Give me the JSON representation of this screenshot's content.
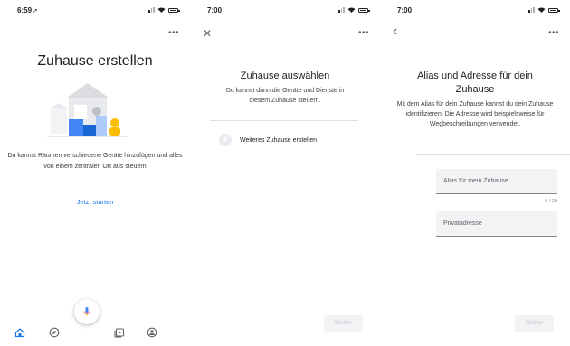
{
  "screen1": {
    "time": "6:59",
    "time_arrow": "➚",
    "title": "Zuhause erstellen",
    "description": "Du kannst Räumen verschiedene Geräte hinzufügen und alles von einem zentralen Ort aus steuern",
    "cta": "Jetzt starten",
    "more": "•••",
    "nav": [
      "home-icon",
      "explore-icon",
      "media-icon",
      "account-icon"
    ]
  },
  "screen2": {
    "time": "7:00",
    "close": "✕",
    "more": "•••",
    "title": "Zuhause auswählen",
    "subtitle": "Du kannst dann die Geräte und Dienste in diesem Zuhause steuern.",
    "add_label": "Weiteres Zuhause erstellen",
    "add_symbol": "+",
    "next": "Weiter"
  },
  "screen3": {
    "time": "7:00",
    "back": "‹",
    "more": "•••",
    "title": "Alias und Adresse für dein Zuhause",
    "description": "Mit dem Alias für dein Zuhause kannst du dein Zuhause identifizieren. Die Adresse wird beispielsweise für Wegbeschreibungen verwendet.",
    "alias_placeholder": "Alias für mein Zuhause",
    "alias_counter": "0 / 20",
    "address_placeholder": "Privatadresse",
    "next": "Weiter"
  },
  "colors": {
    "accent": "#1a73e8",
    "illustration_blue": "#4285f4",
    "illustration_yellow": "#fbbc04",
    "illustration_grey": "#dadce0",
    "mic_red": "#ea4335"
  }
}
